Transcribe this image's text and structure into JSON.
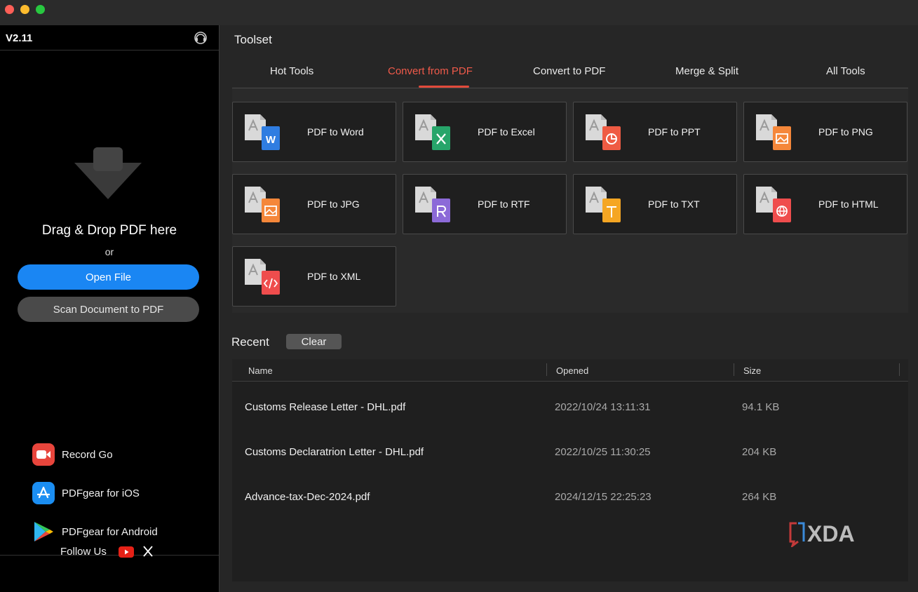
{
  "app": {
    "version": "V2.11"
  },
  "sidebar": {
    "drop_text": "Drag & Drop PDF here",
    "or_text": "or",
    "open_file_label": "Open File",
    "scan_label": "Scan Document to PDF",
    "promos": [
      {
        "label": "Record Go",
        "icon": "record-go-icon"
      },
      {
        "label": "PDFgear for iOS",
        "icon": "app-store-icon"
      },
      {
        "label": "PDFgear for Android",
        "icon": "google-play-icon"
      }
    ],
    "follow_label": "Follow Us"
  },
  "toolset": {
    "title": "Toolset",
    "tabs": [
      {
        "label": "Hot Tools",
        "active": false
      },
      {
        "label": "Convert from PDF",
        "active": true
      },
      {
        "label": "Convert to PDF",
        "active": false
      },
      {
        "label": "Merge & Split",
        "active": false
      },
      {
        "label": "All Tools",
        "active": false
      }
    ],
    "tools": [
      {
        "label": "PDF to Word",
        "icon": "pdf-to-word-icon",
        "color": "#2f7de1"
      },
      {
        "label": "PDF to Excel",
        "icon": "pdf-to-excel-icon",
        "color": "#27a56a"
      },
      {
        "label": "PDF to PPT",
        "icon": "pdf-to-ppt-icon",
        "color": "#ef5b43"
      },
      {
        "label": "PDF to PNG",
        "icon": "pdf-to-png-icon",
        "color": "#f5873a"
      },
      {
        "label": "PDF to JPG",
        "icon": "pdf-to-jpg-icon",
        "color": "#f5873a"
      },
      {
        "label": "PDF to RTF",
        "icon": "pdf-to-rtf-icon",
        "color": "#8c6ad8"
      },
      {
        "label": "PDF to TXT",
        "icon": "pdf-to-txt-icon",
        "color": "#f5a623"
      },
      {
        "label": "PDF to HTML",
        "icon": "pdf-to-html-icon",
        "color": "#ef4d4d"
      },
      {
        "label": "PDF to XML",
        "icon": "pdf-to-xml-icon",
        "color": "#ef4d4d"
      }
    ]
  },
  "recent": {
    "title": "Recent",
    "clear_label": "Clear",
    "columns": [
      "Name",
      "Opened",
      "Size"
    ],
    "rows": [
      {
        "name": "Customs Release Letter - DHL.pdf",
        "opened": "2022/10/24 13:11:31",
        "size": "94.1 KB"
      },
      {
        "name": "Customs Declaratrion Letter - DHL.pdf",
        "opened": "2022/10/25 11:30:25",
        "size": "204 KB"
      },
      {
        "name": "Advance-tax-Dec-2024.pdf",
        "opened": "2024/12/15 22:25:23",
        "size": "264 KB"
      }
    ]
  },
  "watermark": {
    "text": "XDA"
  },
  "colors": {
    "accent": "#e24a3b",
    "primary_button": "#1a86f3"
  }
}
